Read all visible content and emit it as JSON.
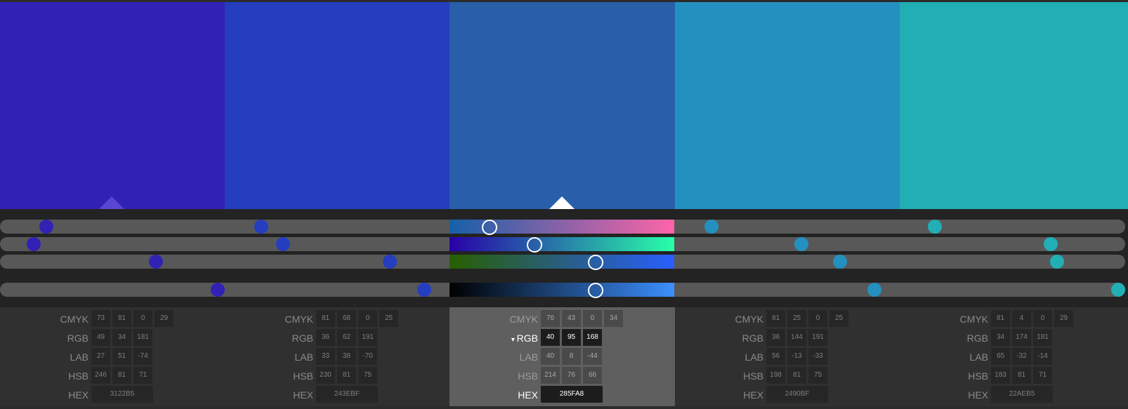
{
  "palette": [
    {
      "hex": "3122B5",
      "color": "#3122B5",
      "cmyk": [
        "73",
        "81",
        "0",
        "29"
      ],
      "rgb": [
        "49",
        "34",
        "181"
      ],
      "lab": [
        "27",
        "51",
        "-74"
      ],
      "hsb": [
        "246",
        "81",
        "71"
      ]
    },
    {
      "hex": "243EBF",
      "color": "#243EBF",
      "cmyk": [
        "81",
        "68",
        "0",
        "25"
      ],
      "rgb": [
        "36",
        "62",
        "191"
      ],
      "lab": [
        "33",
        "38",
        "-70"
      ],
      "hsb": [
        "230",
        "81",
        "75"
      ]
    },
    {
      "hex": "285FA8",
      "color": "#285FA8",
      "cmyk": [
        "76",
        "43",
        "0",
        "34"
      ],
      "rgb": [
        "40",
        "95",
        "168"
      ],
      "lab": [
        "40",
        "8",
        "-44"
      ],
      "hsb": [
        "214",
        "76",
        "66"
      ]
    },
    {
      "hex": "2490BF",
      "color": "#2490BF",
      "cmyk": [
        "81",
        "25",
        "0",
        "25"
      ],
      "rgb": [
        "36",
        "144",
        "191"
      ],
      "lab": [
        "56",
        "-13",
        "-33"
      ],
      "hsb": [
        "198",
        "81",
        "75"
      ]
    },
    {
      "hex": "22AEB5",
      "color": "#22AEB5",
      "cmyk": [
        "81",
        "4",
        "0",
        "29"
      ],
      "rgb": [
        "34",
        "174",
        "181"
      ],
      "lab": [
        "65",
        "-32",
        "-14"
      ],
      "hsb": [
        "183",
        "81",
        "71"
      ]
    }
  ],
  "selected_index": 2,
  "active_mode": "RGB",
  "labels": {
    "cmyk": "CMYK",
    "rgb": "RGB",
    "lab": "LAB",
    "hsb": "HSB",
    "hex": "HEX"
  },
  "active_mode_indicator": "▾",
  "colors": {
    "background": "#2b2b2b",
    "track": "#585858",
    "active_column": "#5f5f5f",
    "hue_gradient": [
      "#1560a8",
      "#ff64a8"
    ],
    "green_gradient": [
      "#2800a8",
      "#28ffa8"
    ],
    "blue_gradient": [
      "#285f00",
      "#285fff"
    ],
    "brightness_gradient": [
      "#000000",
      "#3c8ffe"
    ]
  },
  "slider_values": {
    "red": [
      49,
      36,
      40,
      36,
      34
    ],
    "green": [
      34,
      62,
      95,
      144,
      174
    ],
    "blue": [
      181,
      191,
      168,
      191,
      181
    ],
    "brightness": [
      71,
      75,
      66,
      75,
      71
    ]
  }
}
